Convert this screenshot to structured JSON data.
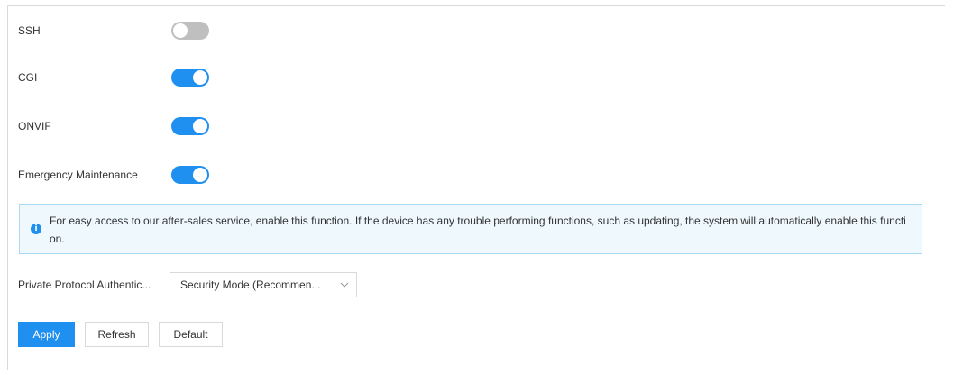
{
  "settings": {
    "ssh": {
      "label": "SSH",
      "enabled": false
    },
    "cgi": {
      "label": "CGI",
      "enabled": true
    },
    "onvif": {
      "label": "ONVIF",
      "enabled": true
    },
    "emergency": {
      "label": "Emergency Maintenance",
      "enabled": true
    }
  },
  "info": {
    "icon": "info-icon",
    "text": "For easy access to our after-sales service, enable this function. If the device has any trouble performing functions, such as updating, the system will automatically enable this function."
  },
  "private_protocol": {
    "label": "Private Protocol Authentic...",
    "value": "Security Mode (Recommen..."
  },
  "buttons": {
    "apply": "Apply",
    "refresh": "Refresh",
    "default": "Default"
  },
  "colors": {
    "accent": "#1f8ff0",
    "toggle_off": "#bfbfbf",
    "info_bg": "#eef8fd",
    "info_border": "#a9daf5"
  }
}
